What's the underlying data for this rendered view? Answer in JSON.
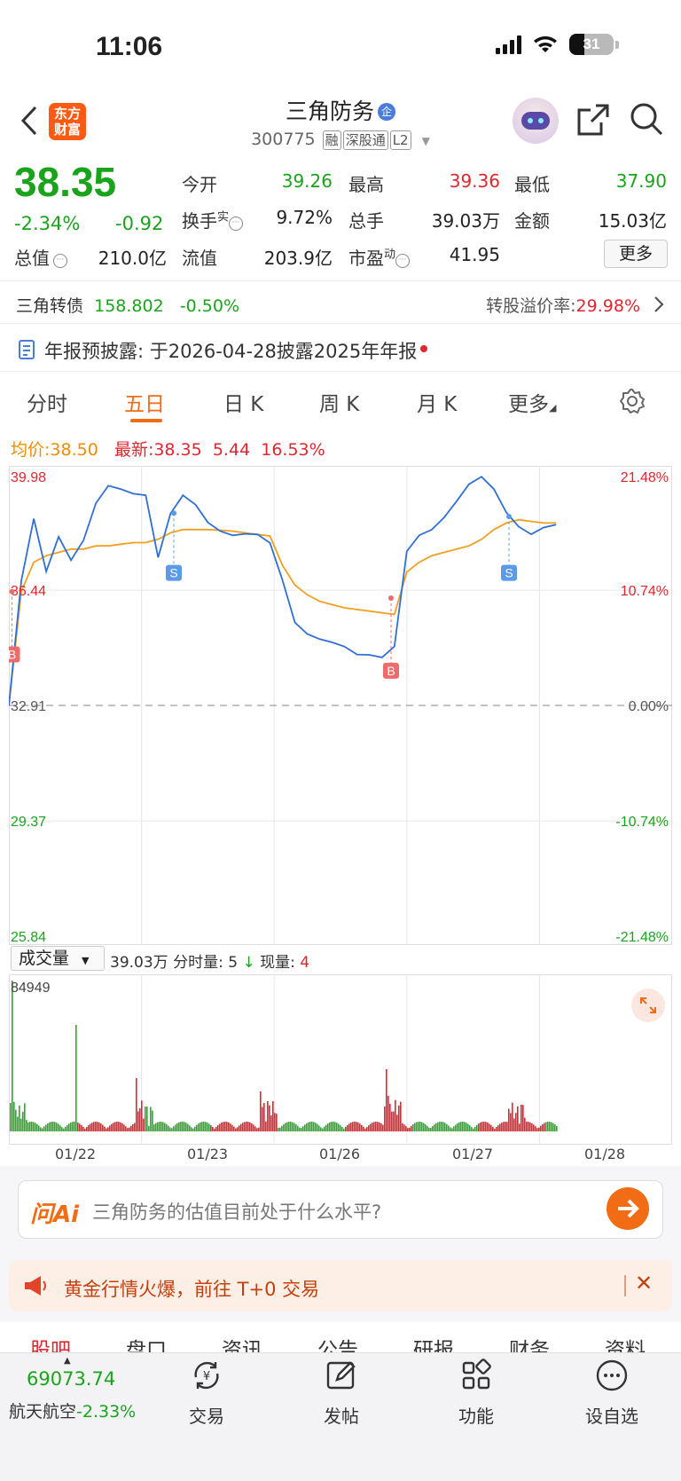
{
  "status_bar": {
    "time": "11:06",
    "battery": "31"
  },
  "header": {
    "logo_text_1": "东方",
    "logo_text_2": "财富",
    "stock_name": "三角防务",
    "qi_badge": "企",
    "stock_code": "300775",
    "tags": [
      "融",
      "深股通",
      "L2"
    ]
  },
  "quote": {
    "price": "38.35",
    "change_pct": "-2.34%",
    "change_abs": "-0.92",
    "fields": {
      "open_label": "今开",
      "open": "39.26",
      "high_label": "最高",
      "high": "39.36",
      "low_label": "最低",
      "low": "37.90",
      "turnover_label": "换手",
      "turnover_sup": "实",
      "turnover": "9.72%",
      "volume_label": "总手",
      "volume": "39.03万",
      "amount_label": "金额",
      "amount": "15.03亿",
      "mktcap_label": "总值",
      "mktcap": "210.0亿",
      "float_label": "流值",
      "float": "203.9亿",
      "pe_label": "市盈",
      "pe_sup": "动",
      "pe": "41.95"
    },
    "more_button": "更多"
  },
  "convertible": {
    "name": "三角转债",
    "price": "158.802",
    "change": "-0.50%",
    "premium_label": "转股溢价率:",
    "premium": "29.98%"
  },
  "notice": {
    "label": "年报预披露:",
    "text": "于2026-04-28披露2025年年报"
  },
  "chart_tabs": [
    "分时",
    "五日",
    "日 K",
    "周 K",
    "月 K",
    "更多"
  ],
  "active_tab": "五日",
  "avg_row": {
    "avg_label": "均价:",
    "avg_value": "38.50",
    "latest_label": "最新:",
    "latest_value": "38.35",
    "diff": "5.44",
    "diff_pct": "16.53%"
  },
  "chart_data": {
    "type": "line",
    "title": "",
    "y_left_ticks": [
      "39.98",
      "36.44",
      "32.91",
      "29.37",
      "25.84"
    ],
    "y_right_ticks": [
      "21.48%",
      "10.74%",
      "0.00%",
      "-10.74%",
      "-21.48%"
    ],
    "ylim": [
      25.84,
      39.98
    ],
    "prev_close": 32.91,
    "x_dates": [
      "01/22",
      "01/23",
      "01/26",
      "01/27",
      "01/28"
    ],
    "series": [
      {
        "name": "",
        "color": "#2f6fd6",
        "values": [
          32.9,
          36.6,
          38.5,
          37.0,
          38.2,
          37.5,
          38.0,
          39.0,
          39.5,
          39.5,
          39.5,
          39.5,
          37.5,
          38.7,
          39.2,
          39.0,
          38.6,
          38.4,
          38.2,
          38.1,
          38.0,
          37.8,
          36.8,
          35.6,
          35.2,
          34.9,
          34.7,
          34.6,
          34.5,
          34.6,
          34.5,
          34.7,
          37.5,
          38.0,
          38.3,
          38.8,
          39.3,
          39.7,
          39.8,
          39.4,
          38.8,
          38.5,
          38.3,
          38.4,
          38.35
        ]
      },
      {
        "name": "",
        "color": "#f0a020",
        "values": [
          32.9,
          36.4,
          37.3,
          37.5,
          37.6,
          37.7,
          37.7,
          37.8,
          37.8,
          37.85,
          37.9,
          37.9,
          38.0,
          38.2,
          38.3,
          38.3,
          38.3,
          38.28,
          38.25,
          38.2,
          38.15,
          38.1,
          37.2,
          36.6,
          36.3,
          36.1,
          36.0,
          35.9,
          35.85,
          35.8,
          35.75,
          35.7,
          37.0,
          37.3,
          37.5,
          37.6,
          37.7,
          37.8,
          38.0,
          38.3,
          38.5,
          38.6,
          38.55,
          38.5,
          38.5
        ]
      }
    ],
    "markers": [
      {
        "label": "B",
        "day": "01/22"
      },
      {
        "label": "S",
        "day": "01/23"
      },
      {
        "label": "B",
        "day": "01/26"
      },
      {
        "label": "S",
        "day": "01/27"
      }
    ],
    "volume": {
      "max_label": "84949",
      "selector": "成交量",
      "total": "39.03万",
      "fenshi_label": "分时量:",
      "fenshi_value": "5",
      "now_label": "现量:",
      "now_value": "4"
    }
  },
  "ai": {
    "logo": "问Ai",
    "question": "三角防务的估值目前处于什么水平?"
  },
  "banner": {
    "text": "黄金行情火爆，前往 T+0 交易"
  },
  "sub_tabs": [
    "股吧",
    "盘口",
    "资讯",
    "公告",
    "研报",
    "财务",
    "资料"
  ],
  "bottom": {
    "index_value": "69073.74",
    "index_name": "航天航空",
    "index_change": "-2.33%",
    "nav": [
      "交易",
      "发帖",
      "功能",
      "设自选"
    ]
  },
  "colors": {
    "up": "#e0262f",
    "down": "#1aa41c",
    "accent": "#f26b15",
    "line": "#2f6fd6",
    "avg": "#f0a020"
  }
}
